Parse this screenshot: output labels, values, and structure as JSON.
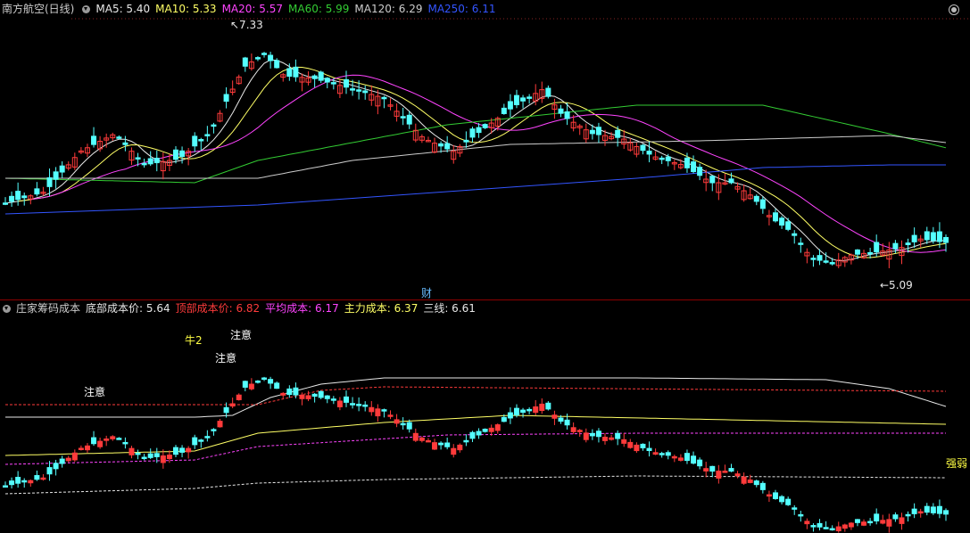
{
  "colors": {
    "up": "#ff3b3b",
    "down": "#54ffff",
    "ma5": "#e8e8e8",
    "ma10": "#ffff66",
    "ma20": "#ff44ff",
    "ma60": "#33cc33",
    "ma120": "#cccccc",
    "ma250": "#3355ff",
    "bg": "#000000"
  },
  "top": {
    "title": "南方航空(日线)",
    "ma": [
      {
        "label": "MA5: 5.40",
        "color": "#e8e8e8"
      },
      {
        "label": "MA10: 5.33",
        "color": "#ffff66"
      },
      {
        "label": "MA20: 5.57",
        "color": "#ff44ff"
      },
      {
        "label": "MA60: 5.99",
        "color": "#33cc33"
      },
      {
        "label": "MA120: 6.29",
        "color": "#cccccc"
      },
      {
        "label": "MA250: 6.11",
        "color": "#3355ff"
      }
    ],
    "high_label": "7.33",
    "low_label": "5.09",
    "event_marker": "财"
  },
  "bottom": {
    "title": "庄家筹码成本",
    "items": [
      {
        "label": "底部成本价: 5.64",
        "color": "#e8e8e8"
      },
      {
        "label": "顶部成本价: 6.82",
        "color": "#ff3b3b"
      },
      {
        "label": "平均成本: 6.17",
        "color": "#ff44ff"
      },
      {
        "label": "主力成本: 6.37",
        "color": "#ffff66"
      },
      {
        "label": "三线: 6.61",
        "color": "#e8e8e8"
      }
    ],
    "annotations": [
      {
        "text": "注意",
        "color": "#ffffff"
      },
      {
        "text": "牛2",
        "color": "#ffff44"
      },
      {
        "text": "注意",
        "color": "#ffffff"
      },
      {
        "text": "注意",
        "color": "#ffffff"
      },
      {
        "text": "强弱",
        "color": "#ffff44"
      }
    ]
  }
}
